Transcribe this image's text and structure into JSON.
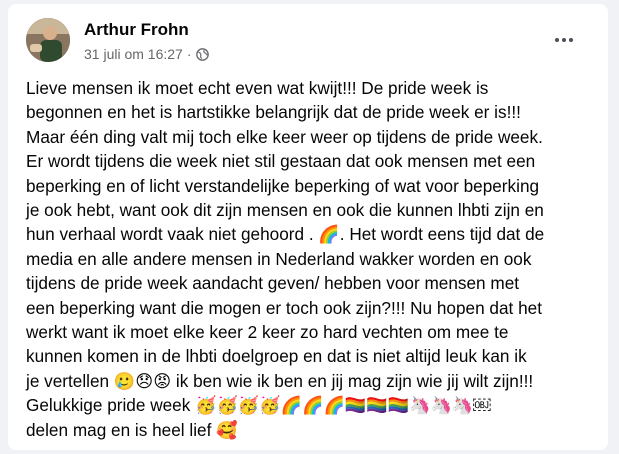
{
  "post": {
    "author": "Arthur Frohn",
    "timestamp": "31 juli om 16:27",
    "separator": "·",
    "privacy_icon": "globe-icon",
    "more_icon": "more-options-icon",
    "lines": [
      "Lieve mensen ik moet echt even wat kwijt!!! De pride week is",
      "begonnen en het is hartstikke belangrijk dat de pride week er is!!!",
      "Maar één ding valt mij toch elke keer weer op tijdens de pride week.",
      "Er wordt tijdens die week niet stil gestaan dat ook mensen met een",
      "beperking en of licht verstandelijke beperking of wat voor beperking",
      "je ook hebt, want ook dit zijn mensen en ook die kunnen lhbti zijn en",
      "hun verhaal wordt vaak niet gehoord . 🌈. Het wordt eens tijd dat de",
      "media en alle andere mensen in Nederland wakker worden en ook",
      "tijdens de pride week aandacht geven/ hebben voor mensen met",
      "een beperking want die mogen er toch ook zijn?!!! Nu hopen dat het",
      "werkt want ik moet elke keer 2 keer zo hard vechten om mee te",
      "kunnen komen in de lhbti doelgroep en dat is niet altijd leuk kan ik",
      "je vertellen 🥲😞😡 ik ben wie ik ben en jij mag zijn wie jij wilt zijn!!!",
      "Gelukkige pride week 🥳🥳🥳🥳🌈🌈🌈🏳️‍🌈🏳️‍🌈🏳️‍🌈🦄🦄🦄￼",
      "delen mag en is heel lief 🥰"
    ]
  }
}
